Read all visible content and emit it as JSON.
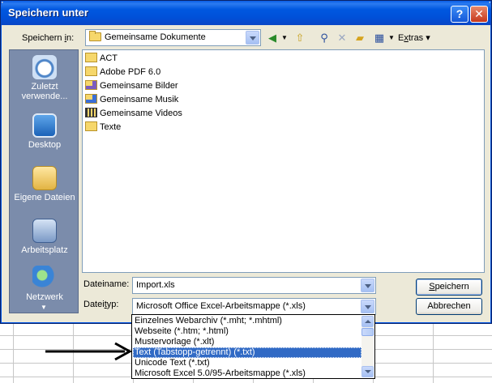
{
  "dialog": {
    "title": "Speichern unter",
    "help_glyph": "?",
    "close_glyph": "✕"
  },
  "save_in": {
    "label_pre": "Speichern ",
    "label_key": "i",
    "label_post": "n:",
    "value": "Gemeinsame Dokumente"
  },
  "toolbar": {
    "tools_key": "x",
    "tools_pre": "E",
    "tools_post": "tras ▾"
  },
  "places": [
    {
      "label": "Zuletzt verwende...",
      "icon": "recent-documents-icon"
    },
    {
      "label": "Desktop",
      "icon": "desktop-icon"
    },
    {
      "label": "Eigene Dateien",
      "icon": "my-documents-icon"
    },
    {
      "label": "Arbeitsplatz",
      "icon": "my-computer-icon"
    },
    {
      "label": "Netzwerk",
      "icon": "network-icon"
    }
  ],
  "files": [
    {
      "name": "ACT",
      "icon": "folder-icon"
    },
    {
      "name": "Adobe PDF 6.0",
      "icon": "folder-icon"
    },
    {
      "name": "Gemeinsame Bilder",
      "icon": "shared-pictures-folder-icon"
    },
    {
      "name": "Gemeinsame Musik",
      "icon": "shared-music-folder-icon"
    },
    {
      "name": "Gemeinsame Videos",
      "icon": "shared-videos-folder-icon"
    },
    {
      "name": "Texte",
      "icon": "folder-icon"
    }
  ],
  "filename": {
    "label_pre": "Dateiname:",
    "value": "Import.xls"
  },
  "filetype": {
    "label_pre": "Datei",
    "label_key": "t",
    "label_post": "yp:",
    "value": "Microsoft Office Excel-Arbeitsmappe (*.xls)",
    "options": [
      "Einzelnes Webarchiv (*.mht; *.mhtml)",
      "Webseite (*.htm; *.html)",
      "Mustervorlage (*.xlt)",
      "Text (Tabstopp-getrennt) (*.txt)",
      "Unicode Text (*.txt)",
      "Microsoft Excel 5.0/95-Arbeitsmappe (*.xls)"
    ],
    "selected_index": 3
  },
  "buttons": {
    "save_key": "S",
    "save_post": "peichern",
    "cancel": "Abbrechen"
  },
  "colors": {
    "title_bar": "#0054e3",
    "selection": "#316ac5",
    "places_bar": "#7b8cab"
  }
}
